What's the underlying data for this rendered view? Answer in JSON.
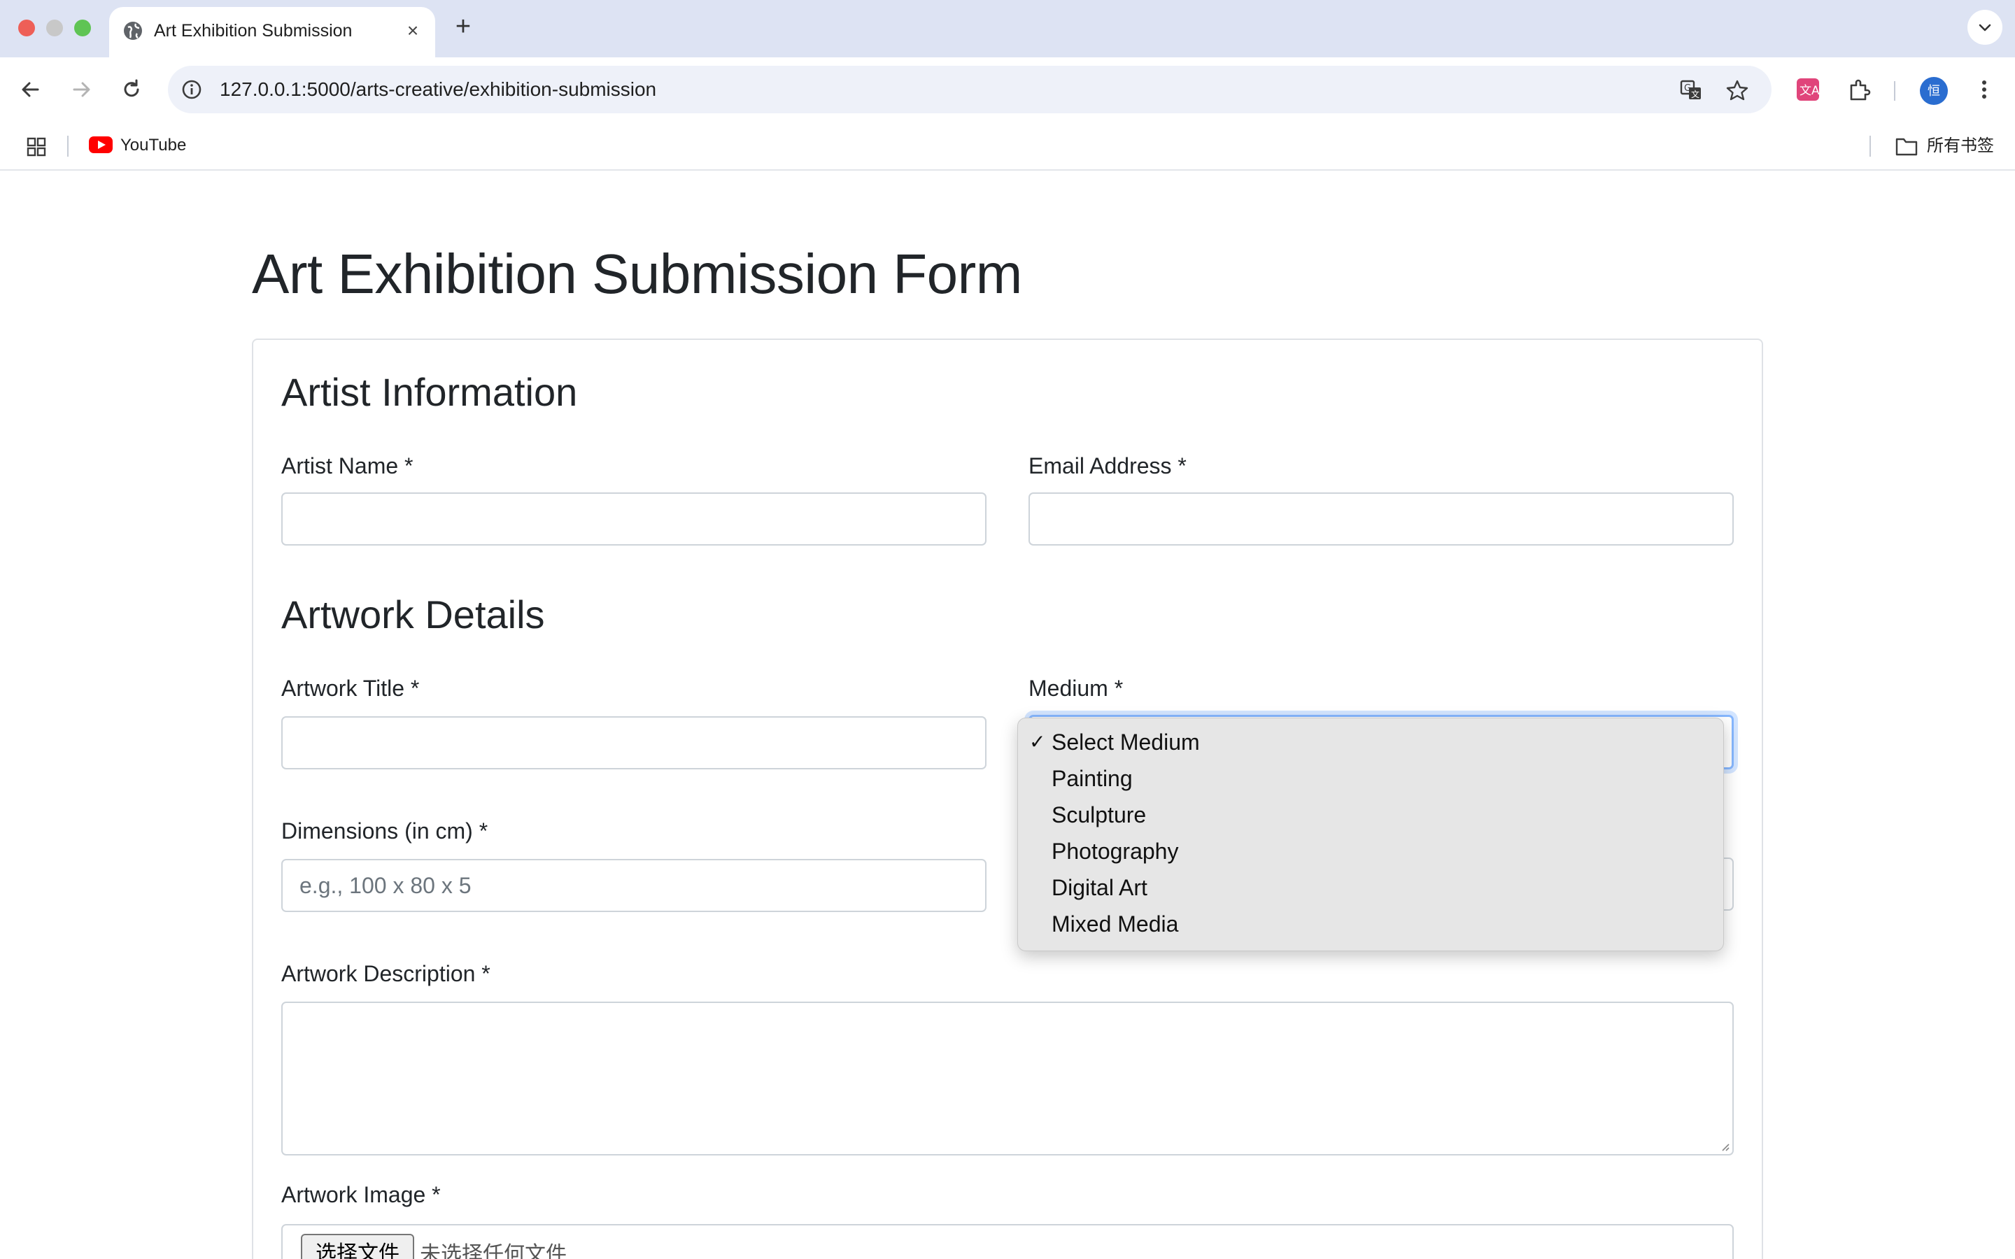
{
  "browser": {
    "tab_title": "Art Exhibition Submission",
    "new_tab_label": "+",
    "url": "127.0.0.1:5000/arts-creative/exhibition-submission",
    "profile_initial": "恒",
    "bookmarks": [
      {
        "label": "YouTube",
        "icon": "youtube-icon"
      }
    ],
    "all_bookmarks_label": "所有书签"
  },
  "page": {
    "title": "Art Exhibition Submission Form"
  },
  "form": {
    "artist_section_title": "Artist Information",
    "artist_name_label": "Artist Name *",
    "artist_name_value": "",
    "email_label": "Email Address *",
    "email_value": "",
    "artwork_section_title": "Artwork Details",
    "artwork_title_label": "Artwork Title *",
    "artwork_title_value": "",
    "medium_label": "Medium *",
    "medium_selected": "Select Medium",
    "medium_options": [
      "Select Medium",
      "Painting",
      "Sculpture",
      "Photography",
      "Digital Art",
      "Mixed Media"
    ],
    "dimensions_label": "Dimensions (in cm) *",
    "dimensions_placeholder": "e.g., 100 x 80 x 5",
    "description_label": "Artwork Description *",
    "description_value": "",
    "image_label": "Artwork Image *",
    "file_button_label": "选择文件",
    "file_status": "未选择任何文件"
  },
  "colors": {
    "focus_border": "#86b7fe",
    "input_border": "#ced4da",
    "text": "#212529",
    "placeholder": "#6c757d"
  }
}
